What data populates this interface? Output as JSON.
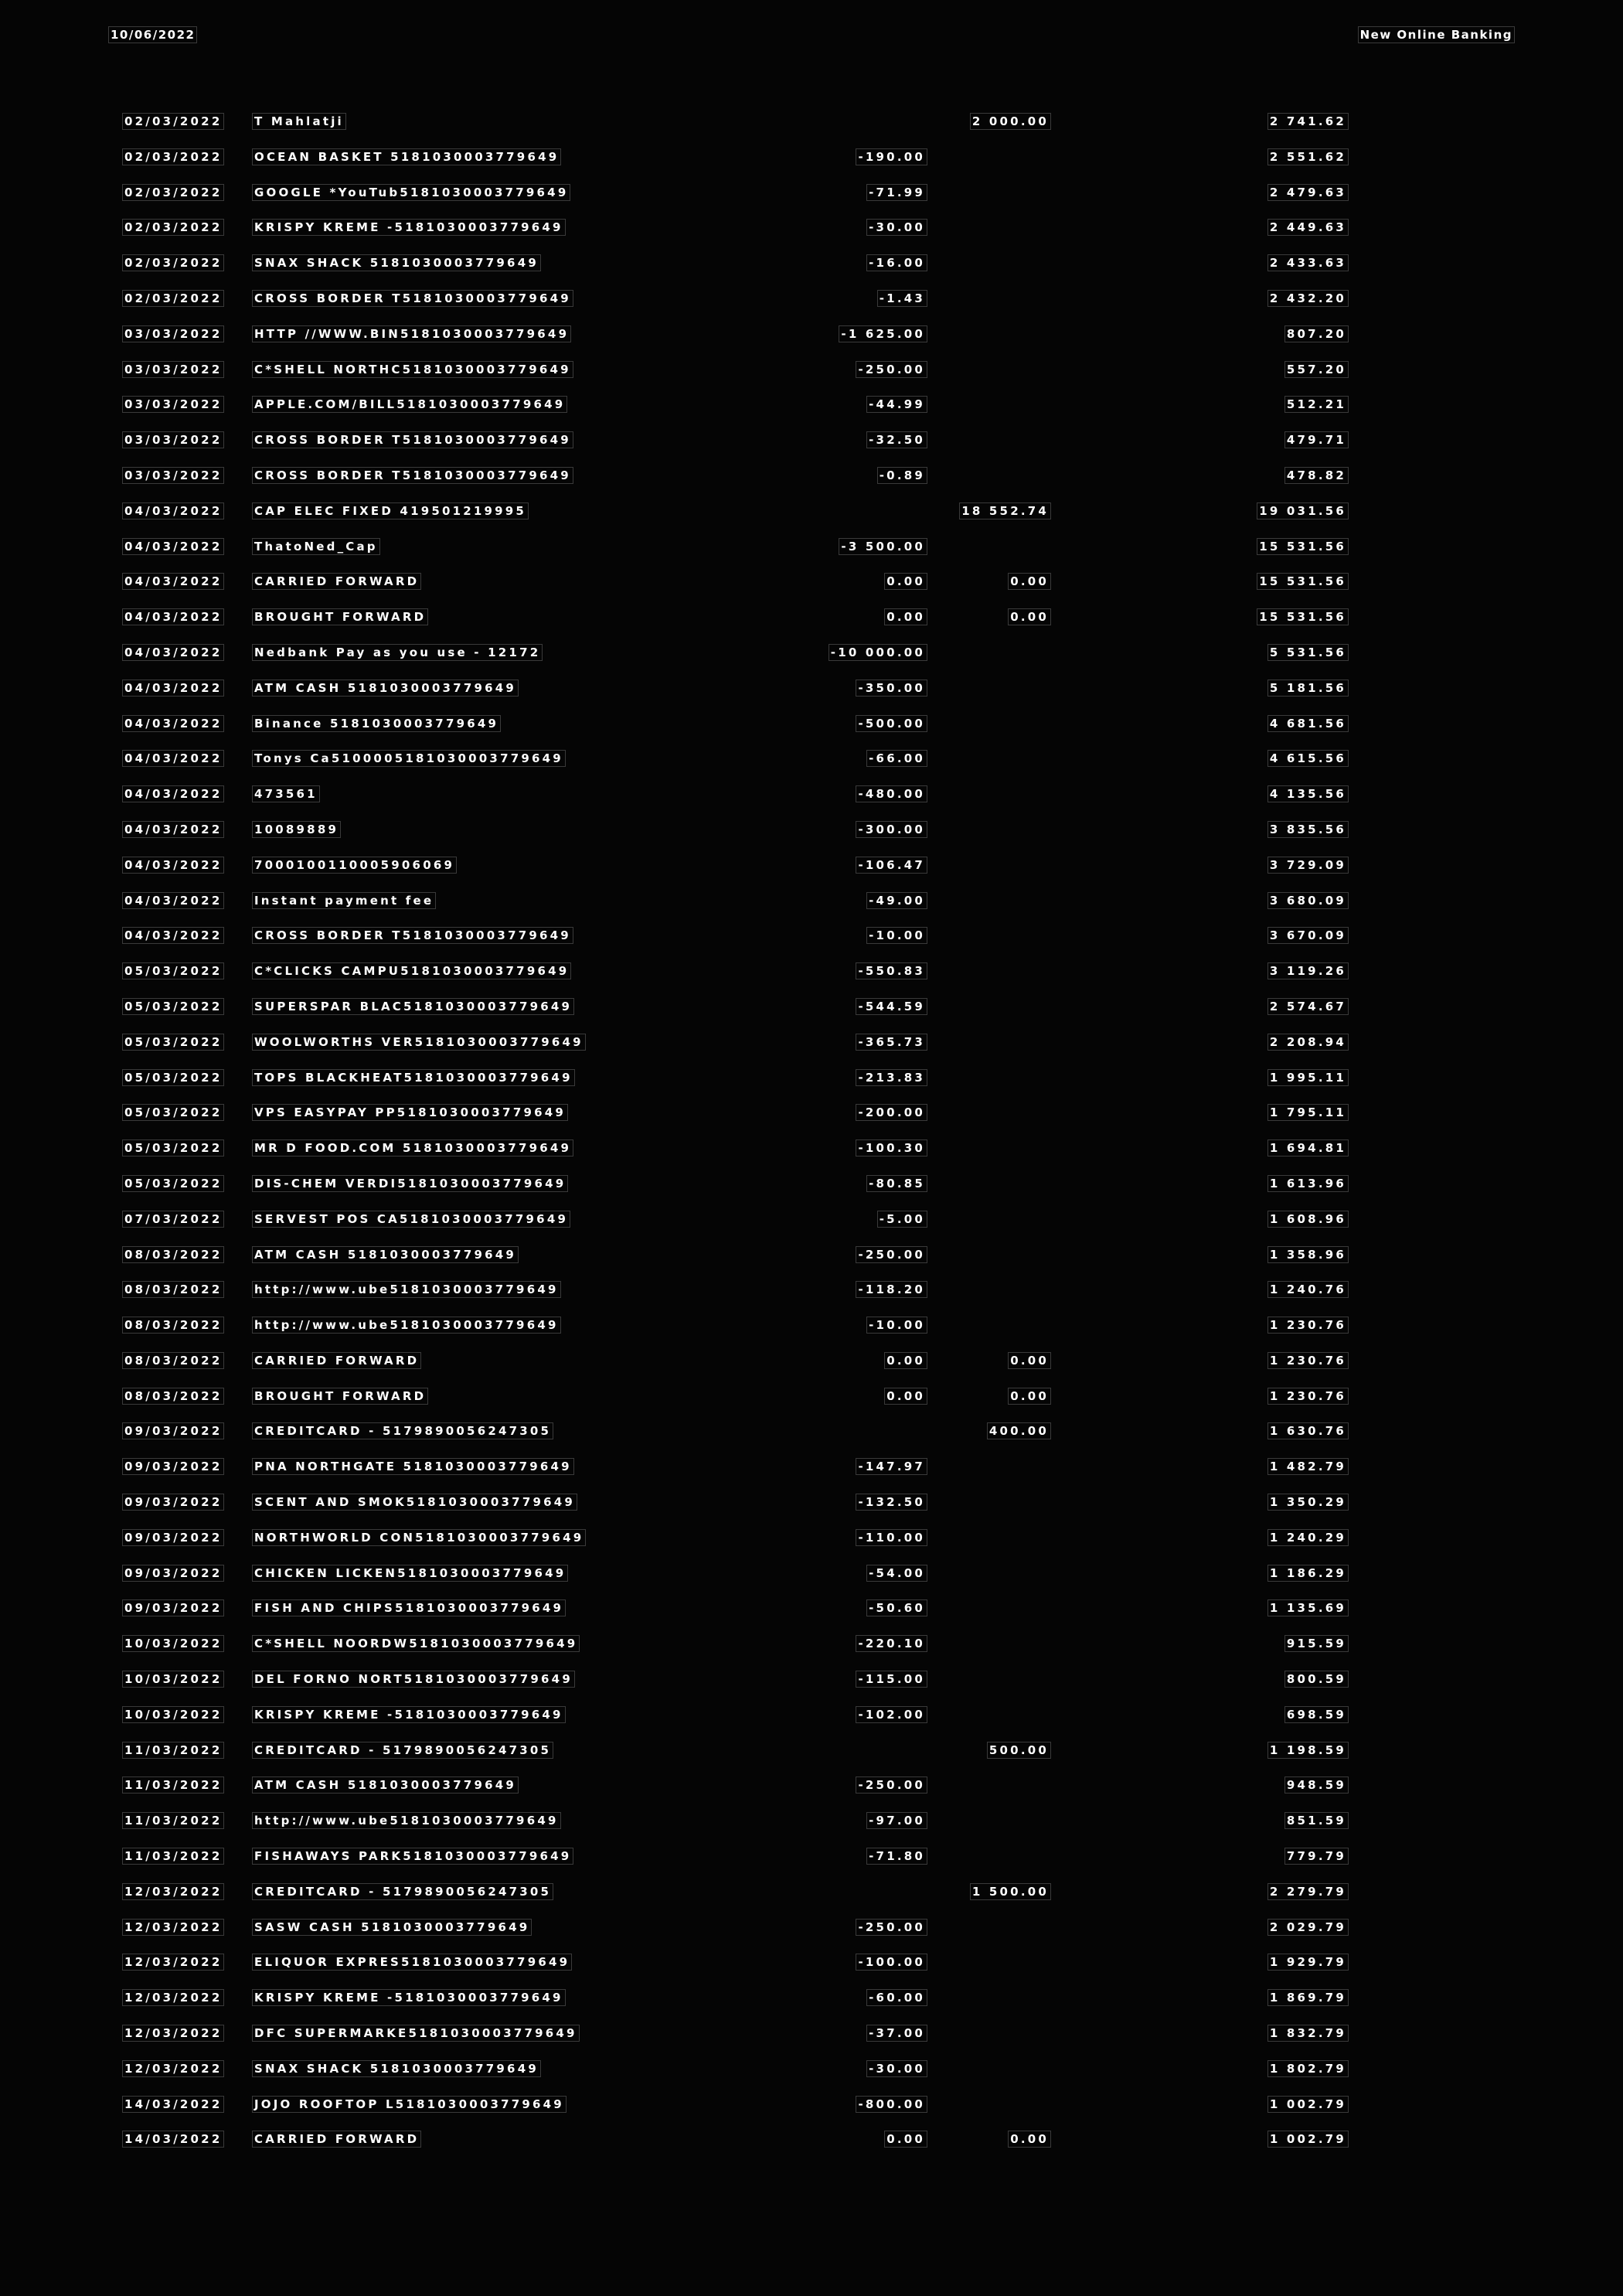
{
  "header": {
    "print_date": "10/06/2022",
    "title": "New Online Banking"
  },
  "transactions": [
    {
      "date": "02/03/2022",
      "description": "T Mahlatji",
      "debit": "",
      "credit": "2 000.00",
      "balance": "2 741.62"
    },
    {
      "date": "02/03/2022",
      "description": "OCEAN BASKET 5181030003779649",
      "debit": "-190.00",
      "credit": "",
      "balance": "2 551.62"
    },
    {
      "date": "02/03/2022",
      "description": "GOOGLE *YouTub5181030003779649",
      "debit": "-71.99",
      "credit": "",
      "balance": "2 479.63"
    },
    {
      "date": "02/03/2022",
      "description": "KRISPY KREME -5181030003779649",
      "debit": "-30.00",
      "credit": "",
      "balance": "2 449.63"
    },
    {
      "date": "02/03/2022",
      "description": "SNAX SHACK 5181030003779649",
      "debit": "-16.00",
      "credit": "",
      "balance": "2 433.63"
    },
    {
      "date": "02/03/2022",
      "description": "CROSS BORDER T5181030003779649",
      "debit": "-1.43",
      "credit": "",
      "balance": "2 432.20"
    },
    {
      "date": "03/03/2022",
      "description": "HTTP //WWW.BIN5181030003779649",
      "debit": "-1 625.00",
      "credit": "",
      "balance": "807.20"
    },
    {
      "date": "03/03/2022",
      "description": "C*SHELL NORTHC5181030003779649",
      "debit": "-250.00",
      "credit": "",
      "balance": "557.20"
    },
    {
      "date": "03/03/2022",
      "description": "APPLE.COM/BILL5181030003779649",
      "debit": "-44.99",
      "credit": "",
      "balance": "512.21"
    },
    {
      "date": "03/03/2022",
      "description": "CROSS BORDER T5181030003779649",
      "debit": "-32.50",
      "credit": "",
      "balance": "479.71"
    },
    {
      "date": "03/03/2022",
      "description": "CROSS BORDER T5181030003779649",
      "debit": "-0.89",
      "credit": "",
      "balance": "478.82"
    },
    {
      "date": "04/03/2022",
      "description": "CAP ELEC FIXED 419501219995",
      "debit": "",
      "credit": "18 552.74",
      "balance": "19 031.56"
    },
    {
      "date": "04/03/2022",
      "description": "ThatoNed_Cap",
      "debit": "-3 500.00",
      "credit": "",
      "balance": "15 531.56"
    },
    {
      "date": "04/03/2022",
      "description": "CARRIED FORWARD",
      "debit": "0.00",
      "credit": "0.00",
      "balance": "15 531.56"
    },
    {
      "date": "04/03/2022",
      "description": "BROUGHT FORWARD",
      "debit": "0.00",
      "credit": "0.00",
      "balance": "15 531.56"
    },
    {
      "date": "04/03/2022",
      "description": "Nedbank Pay as you use - 12172",
      "debit": "-10 000.00",
      "credit": "",
      "balance": "5 531.56"
    },
    {
      "date": "04/03/2022",
      "description": "ATM CASH 5181030003779649",
      "debit": "-350.00",
      "credit": "",
      "balance": "5 181.56"
    },
    {
      "date": "04/03/2022",
      "description": "Binance 5181030003779649",
      "debit": "-500.00",
      "credit": "",
      "balance": "4 681.56"
    },
    {
      "date": "04/03/2022",
      "description": "Tonys Ca5100005181030003779649",
      "debit": "-66.00",
      "credit": "",
      "balance": "4 615.56"
    },
    {
      "date": "04/03/2022",
      "description": "473561",
      "debit": "-480.00",
      "credit": "",
      "balance": "4 135.56"
    },
    {
      "date": "04/03/2022",
      "description": "10089889",
      "debit": "-300.00",
      "credit": "",
      "balance": "3 835.56"
    },
    {
      "date": "04/03/2022",
      "description": "7000100110005906069",
      "debit": "-106.47",
      "credit": "",
      "balance": "3 729.09"
    },
    {
      "date": "04/03/2022",
      "description": "Instant payment fee",
      "debit": "-49.00",
      "credit": "",
      "balance": "3 680.09"
    },
    {
      "date": "04/03/2022",
      "description": "CROSS BORDER T5181030003779649",
      "debit": "-10.00",
      "credit": "",
      "balance": "3 670.09"
    },
    {
      "date": "05/03/2022",
      "description": "C*CLICKS CAMPU5181030003779649",
      "debit": "-550.83",
      "credit": "",
      "balance": "3 119.26"
    },
    {
      "date": "05/03/2022",
      "description": "SUPERSPAR BLAC5181030003779649",
      "debit": "-544.59",
      "credit": "",
      "balance": "2 574.67"
    },
    {
      "date": "05/03/2022",
      "description": "WOOLWORTHS VER5181030003779649",
      "debit": "-365.73",
      "credit": "",
      "balance": "2 208.94"
    },
    {
      "date": "05/03/2022",
      "description": "TOPS BLACKHEAT5181030003779649",
      "debit": "-213.83",
      "credit": "",
      "balance": "1 995.11"
    },
    {
      "date": "05/03/2022",
      "description": "VPS EASYPAY PP5181030003779649",
      "debit": "-200.00",
      "credit": "",
      "balance": "1 795.11"
    },
    {
      "date": "05/03/2022",
      "description": "MR D FOOD.COM 5181030003779649",
      "debit": "-100.30",
      "credit": "",
      "balance": "1 694.81"
    },
    {
      "date": "05/03/2022",
      "description": "DIS-CHEM VERDI5181030003779649",
      "debit": "-80.85",
      "credit": "",
      "balance": "1 613.96"
    },
    {
      "date": "07/03/2022",
      "description": "SERVEST POS CA5181030003779649",
      "debit": "-5.00",
      "credit": "",
      "balance": "1 608.96"
    },
    {
      "date": "08/03/2022",
      "description": "ATM CASH 5181030003779649",
      "debit": "-250.00",
      "credit": "",
      "balance": "1 358.96"
    },
    {
      "date": "08/03/2022",
      "description": "http://www.ube5181030003779649",
      "debit": "-118.20",
      "credit": "",
      "balance": "1 240.76"
    },
    {
      "date": "08/03/2022",
      "description": "http://www.ube5181030003779649",
      "debit": "-10.00",
      "credit": "",
      "balance": "1 230.76"
    },
    {
      "date": "08/03/2022",
      "description": "CARRIED FORWARD",
      "debit": "0.00",
      "credit": "0.00",
      "balance": "1 230.76"
    },
    {
      "date": "08/03/2022",
      "description": "BROUGHT FORWARD",
      "debit": "0.00",
      "credit": "0.00",
      "balance": "1 230.76"
    },
    {
      "date": "09/03/2022",
      "description": "CREDITCARD - 5179890056247305",
      "debit": "",
      "credit": "400.00",
      "balance": "1 630.76"
    },
    {
      "date": "09/03/2022",
      "description": "PNA NORTHGATE 5181030003779649",
      "debit": "-147.97",
      "credit": "",
      "balance": "1 482.79"
    },
    {
      "date": "09/03/2022",
      "description": "SCENT AND SMOK5181030003779649",
      "debit": "-132.50",
      "credit": "",
      "balance": "1 350.29"
    },
    {
      "date": "09/03/2022",
      "description": "NORTHWORLD CON5181030003779649",
      "debit": "-110.00",
      "credit": "",
      "balance": "1 240.29"
    },
    {
      "date": "09/03/2022",
      "description": "CHICKEN LICKEN5181030003779649",
      "debit": "-54.00",
      "credit": "",
      "balance": "1 186.29"
    },
    {
      "date": "09/03/2022",
      "description": "FISH AND CHIPS5181030003779649",
      "debit": "-50.60",
      "credit": "",
      "balance": "1 135.69"
    },
    {
      "date": "10/03/2022",
      "description": "C*SHELL NOORDW5181030003779649",
      "debit": "-220.10",
      "credit": "",
      "balance": "915.59"
    },
    {
      "date": "10/03/2022",
      "description": "DEL FORNO NORT5181030003779649",
      "debit": "-115.00",
      "credit": "",
      "balance": "800.59"
    },
    {
      "date": "10/03/2022",
      "description": "KRISPY KREME -5181030003779649",
      "debit": "-102.00",
      "credit": "",
      "balance": "698.59"
    },
    {
      "date": "11/03/2022",
      "description": "CREDITCARD - 5179890056247305",
      "debit": "",
      "credit": "500.00",
      "balance": "1 198.59"
    },
    {
      "date": "11/03/2022",
      "description": "ATM CASH 5181030003779649",
      "debit": "-250.00",
      "credit": "",
      "balance": "948.59"
    },
    {
      "date": "11/03/2022",
      "description": "http://www.ube5181030003779649",
      "debit": "-97.00",
      "credit": "",
      "balance": "851.59"
    },
    {
      "date": "11/03/2022",
      "description": "FISHAWAYS PARK5181030003779649",
      "debit": "-71.80",
      "credit": "",
      "balance": "779.79"
    },
    {
      "date": "12/03/2022",
      "description": "CREDITCARD - 5179890056247305",
      "debit": "",
      "credit": "1 500.00",
      "balance": "2 279.79"
    },
    {
      "date": "12/03/2022",
      "description": "SASW CASH 5181030003779649",
      "debit": "-250.00",
      "credit": "",
      "balance": "2 029.79"
    },
    {
      "date": "12/03/2022",
      "description": "ELIQUOR EXPRES5181030003779649",
      "debit": "-100.00",
      "credit": "",
      "balance": "1 929.79"
    },
    {
      "date": "12/03/2022",
      "description": "KRISPY KREME -5181030003779649",
      "debit": "-60.00",
      "credit": "",
      "balance": "1 869.79"
    },
    {
      "date": "12/03/2022",
      "description": "DFC SUPERMARKE5181030003779649",
      "debit": "-37.00",
      "credit": "",
      "balance": "1 832.79"
    },
    {
      "date": "12/03/2022",
      "description": "SNAX SHACK 5181030003779649",
      "debit": "-30.00",
      "credit": "",
      "balance": "1 802.79"
    },
    {
      "date": "14/03/2022",
      "description": "JOJO ROOFTOP L5181030003779649",
      "debit": "-800.00",
      "credit": "",
      "balance": "1 002.79"
    },
    {
      "date": "14/03/2022",
      "description": "CARRIED FORWARD",
      "debit": "0.00",
      "credit": "0.00",
      "balance": "1 002.79"
    }
  ]
}
